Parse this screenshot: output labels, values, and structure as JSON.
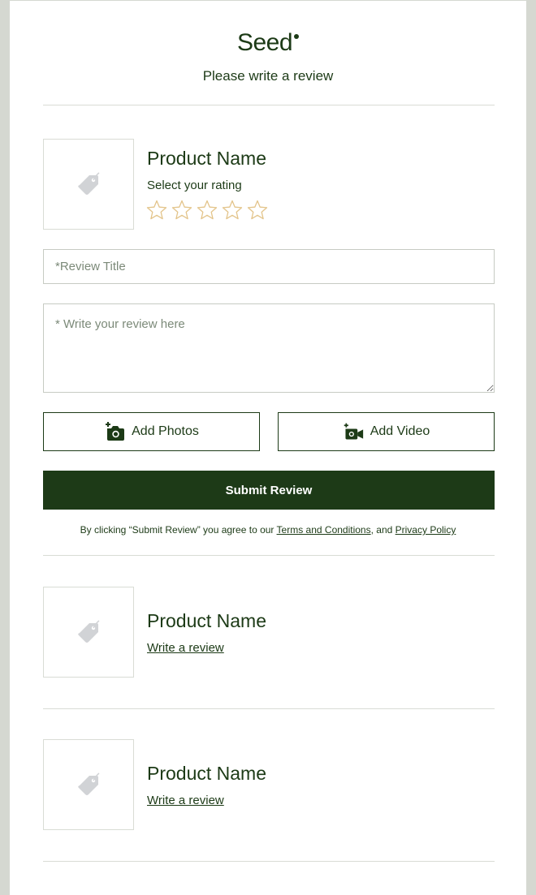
{
  "brand": {
    "name": "Seed"
  },
  "header": {
    "subtitle": "Please write a review"
  },
  "active_product": {
    "name": "Product Name",
    "rating_label": "Select your rating",
    "rating": 0,
    "max_rating": 5,
    "thumbnail_icon": "tag-icon",
    "star_color": "#e3c48a"
  },
  "form": {
    "title_placeholder": "*Review Title",
    "title_value": "",
    "review_placeholder": "* Write your review here",
    "review_value": "",
    "add_photos_label": "Add Photos",
    "add_photos_icon": "add-camera-icon",
    "add_video_label": "Add Video",
    "add_video_icon": "add-video-icon",
    "submit_label": "Submit Review",
    "submit_color": "#1d3a17"
  },
  "legal": {
    "prefix": "By clicking “Submit Review” you agree to our ",
    "terms_label": "Terms and Conditions",
    "middle": ", and ",
    "privacy_label": "Privacy Policy"
  },
  "other_products": [
    {
      "name": "Product Name",
      "link_label": "Write a review",
      "thumbnail_icon": "tag-icon"
    },
    {
      "name": "Product Name",
      "link_label": "Write a review",
      "thumbnail_icon": "tag-icon"
    }
  ]
}
